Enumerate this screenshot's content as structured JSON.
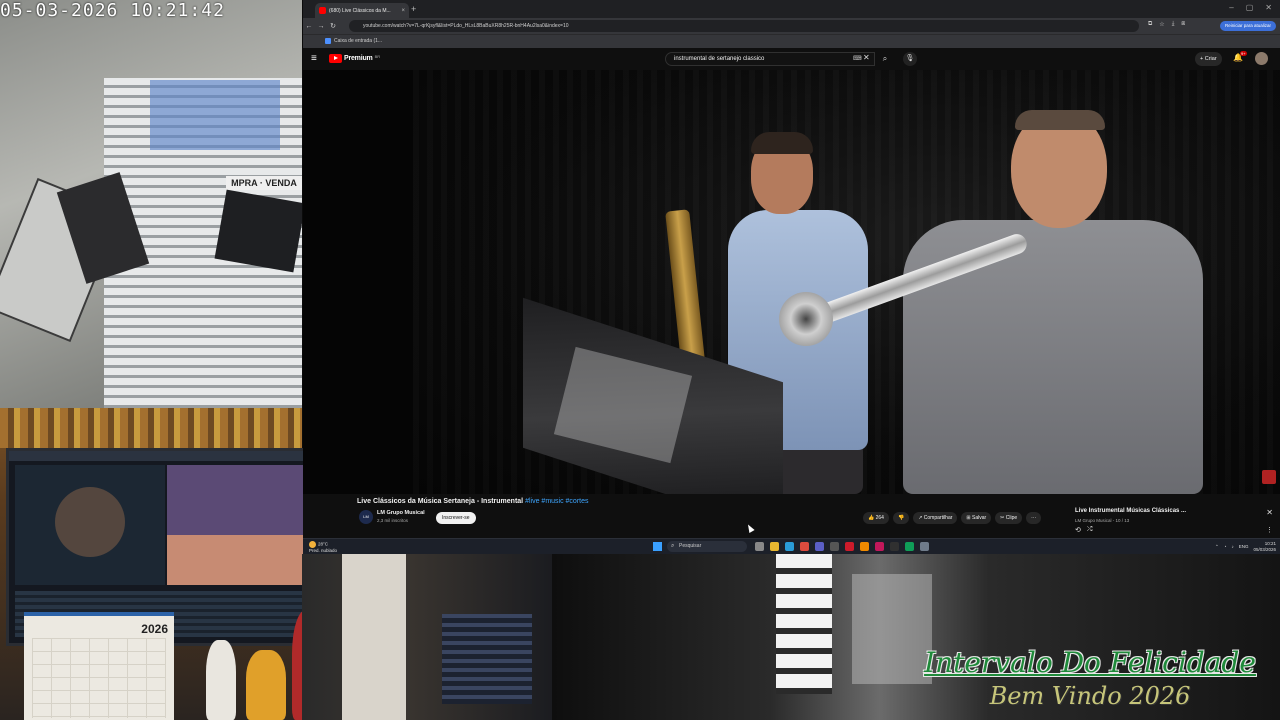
{
  "camera": {
    "timestamp": "05-03-2026  10:21:42",
    "sign_text": "MPRA · VENDA",
    "calendar_year": "2026"
  },
  "overlay": {
    "title": "Intervalo Do Felicidade",
    "subtitle": "Bem Vindo 2026"
  },
  "browser": {
    "tab_title": "(680) Live Clássicos da M...",
    "tab_close": "×",
    "new_tab": "+",
    "url": "youtube.com/watch?v=7L-qrKjsyfl&list=PLdo_HLsL8BaBuXR8h25R-bnH4Au2lsa0&index=10",
    "resume_label": "Reiniciar para atualizar",
    "bookmark": "Caixa de entrada (1...",
    "window_controls": [
      "–",
      "▢",
      "✕"
    ]
  },
  "youtube": {
    "logo": "Premium",
    "logo_region": "BR",
    "search_value": "instrumental de sertanejo classico",
    "create_label": "+ Criar",
    "bell_badge": "9+",
    "video_title": "Live Clássicos da Música Sertaneja - Instrumental",
    "video_tags": "#live #music #cortes",
    "channel_name": "LM Grupo Musical",
    "channel_subs": "2,3 mil inscritos",
    "channel_initials": "LM",
    "subscribe_label": "Inscrever-se",
    "like_label": "👍 264",
    "dislike_label": "👎",
    "share_label": "↗ Compartilhar",
    "save_label": "⊞ Salvar",
    "clip_label": "✂ Clipe",
    "more_label": "···"
  },
  "playlist": {
    "title": "Live Instrumental Músicas Clássicas ...",
    "meta": "LM Grupo Musical - 10 / 13",
    "close": "✕",
    "loop_icon": "⟲",
    "shuffle_icon": "⤮",
    "more": "⋮"
  },
  "taskbar": {
    "temp": "28°C",
    "weather_text": "Pred. nublado",
    "search_placeholder": "Pesquisar",
    "lang": "ENG",
    "time": "10:21",
    "date": "05/03/2026"
  },
  "colors": {
    "youtube_red": "#ff0000",
    "link_blue": "#3ea6ff",
    "overlay_green": "#1f8a3a",
    "overlay_gold": "#c6c57a",
    "taskbar": "#1c2029"
  }
}
